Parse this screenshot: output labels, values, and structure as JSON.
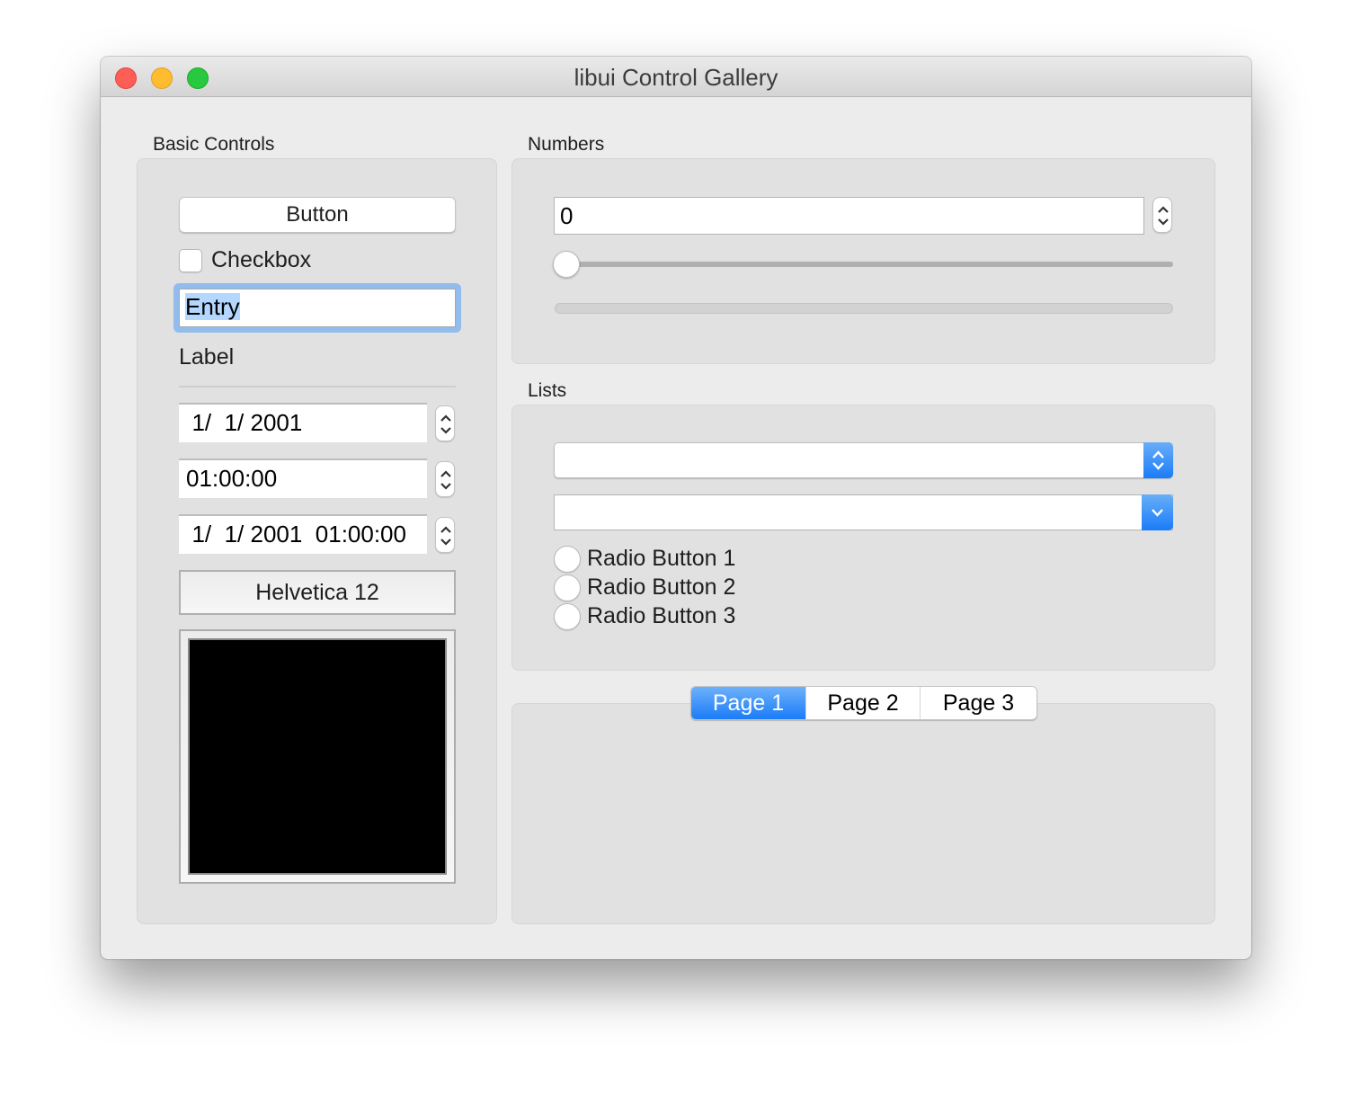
{
  "window": {
    "title": "libui Control Gallery",
    "traffic_lights": [
      {
        "name": "close",
        "color": "#fd5f57"
      },
      {
        "name": "minimize",
        "color": "#febc2e"
      },
      {
        "name": "zoom",
        "color": "#28c840"
      }
    ]
  },
  "basic_controls": {
    "group_label": "Basic Controls",
    "button_label": "Button",
    "checkbox": {
      "label": "Checkbox",
      "checked": false
    },
    "entry": {
      "value": "Entry",
      "selected": true
    },
    "label_text": "Label",
    "date_picker": {
      "value": "  1/  1/ 2001"
    },
    "time_picker": {
      "value": "01:00:00"
    },
    "datetime_picker": {
      "value": "  1/  1/ 2001  01:00:00"
    },
    "font_button_label": "Helvetica 12",
    "color_well": {
      "color": "#000000"
    }
  },
  "numbers": {
    "group_label": "Numbers",
    "spinbox": {
      "value": "0"
    },
    "slider": {
      "value": 0,
      "min": 0,
      "max": 100
    },
    "progress": {
      "value": 0,
      "max": 100
    }
  },
  "lists": {
    "group_label": "Lists",
    "popup_button": {
      "selected": ""
    },
    "combobox": {
      "value": ""
    },
    "radio_buttons": [
      {
        "label": "Radio Button 1",
        "checked": false
      },
      {
        "label": "Radio Button 2",
        "checked": false
      },
      {
        "label": "Radio Button 3",
        "checked": false
      }
    ]
  },
  "tabs": {
    "items": [
      {
        "label": "Page 1",
        "active": true
      },
      {
        "label": "Page 2",
        "active": false
      },
      {
        "label": "Page 3",
        "active": false
      }
    ]
  },
  "colors": {
    "accent": "#1a7cf8",
    "focus_ring": "#92bceb",
    "selection": "#b3d7ff",
    "window_bg": "#ececec",
    "group_bg": "#e1e1e1"
  }
}
